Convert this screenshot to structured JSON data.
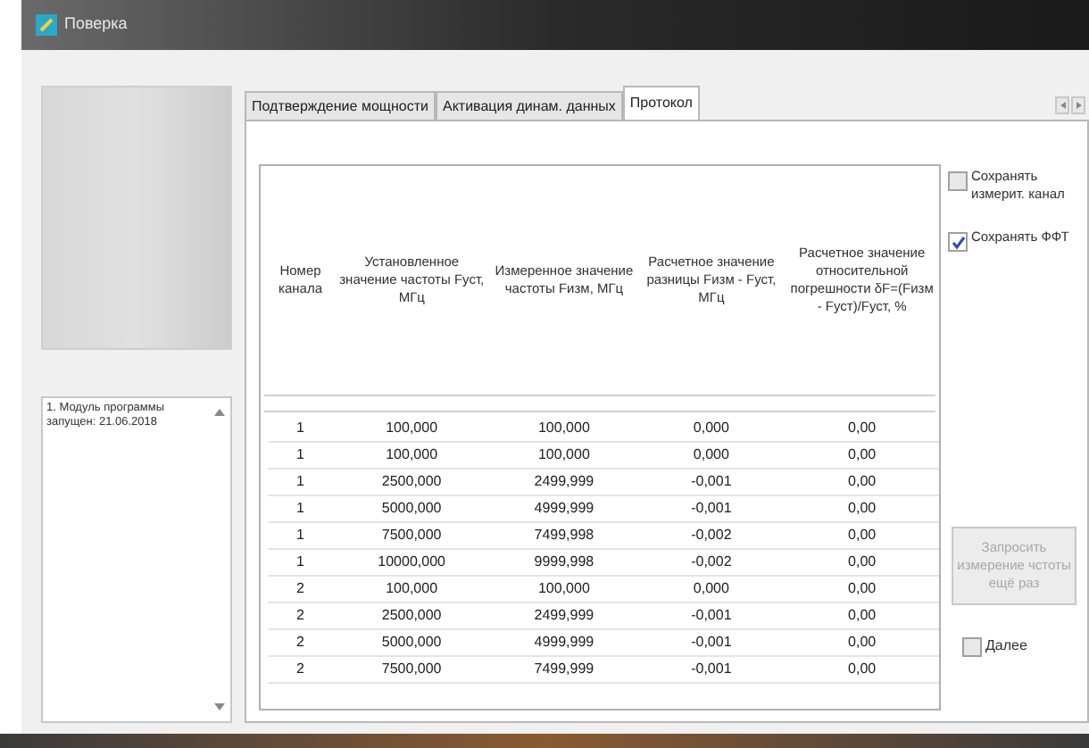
{
  "window": {
    "title": "Поверка"
  },
  "log": {
    "entries": [
      "1. Модуль программы запущен: 21.06.2018"
    ]
  },
  "tabs": [
    {
      "label": "Подтверждение мощности",
      "selected": false
    },
    {
      "label": "Активация динам. данных",
      "selected": false
    },
    {
      "label": "Протокол",
      "selected": true
    }
  ],
  "table": {
    "columns": [
      "Номер канала",
      "Установленное значение частоты Fуст, МГц",
      "Измеренное значение частоты Fизм, МГц",
      "Расчетное значение разницы Fизм - Fуст, МГц",
      "Расчетное значение относительной погрешности δF=(Fизм - Fуст)/Fуст, %"
    ],
    "rows": [
      [
        "1",
        "100,000",
        "100,000",
        "0,000",
        "0,00"
      ],
      [
        "1",
        "100,000",
        "100,000",
        "0,000",
        "0,00"
      ],
      [
        "1",
        "2500,000",
        "2499,999",
        "-0,001",
        "0,00"
      ],
      [
        "1",
        "5000,000",
        "4999,999",
        "-0,001",
        "0,00"
      ],
      [
        "1",
        "7500,000",
        "7499,998",
        "-0,002",
        "0,00"
      ],
      [
        "1",
        "10000,000",
        "9999,998",
        "-0,002",
        "0,00"
      ],
      [
        "2",
        "100,000",
        "100,000",
        "0,000",
        "0,00"
      ],
      [
        "2",
        "2500,000",
        "2499,999",
        "-0,001",
        "0,00"
      ],
      [
        "2",
        "5000,000",
        "4999,999",
        "-0,001",
        "0,00"
      ],
      [
        "2",
        "7500,000",
        "7499,999",
        "-0,001",
        "0,00"
      ]
    ]
  },
  "options": [
    {
      "label": "Сохранять измерит. канал",
      "checked": false
    },
    {
      "label": "Сохранять ФФТ",
      "checked": true
    }
  ],
  "repeat_button": {
    "label": "Запросить измерение чстоты ещё раз",
    "disabled": true
  },
  "next": {
    "label": "Далее",
    "checked": false
  }
}
